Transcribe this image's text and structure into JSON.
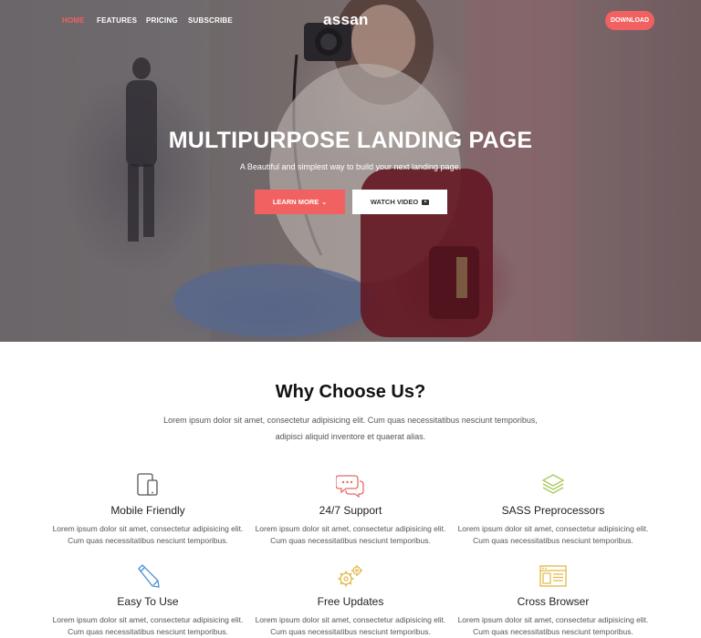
{
  "nav": {
    "links": [
      "HOME",
      "FEATURES",
      "PRICING",
      "SUBSCRIBE"
    ],
    "logo": "assan",
    "download": "DOWNLOAD"
  },
  "hero": {
    "title": "MULTIPURPOSE LANDING PAGE",
    "subtitle": "A Beautiful and simplest way to build your next landing page.",
    "learn_more": "LEARN MORE",
    "watch_video": "WATCH VIDEO"
  },
  "why": {
    "title": "Why Choose Us?",
    "desc_line1": "Lorem ipsum dolor sit amet, consectetur adipisicing elit. Cum quas necessitatibus nesciunt temporibus,",
    "desc_line2": "adipisci aliquid inventore et quaerat alias."
  },
  "features": [
    {
      "title": "Mobile Friendly",
      "line1": "Lorem ipsum dolor sit amet, consectetur adipisicing elit.",
      "line2": "Cum quas necessitatibus nesciunt temporibus."
    },
    {
      "title": "24/7 Support",
      "line1": "Lorem ipsum dolor sit amet, consectetur adipisicing elit.",
      "line2": "Cum quas necessitatibus nesciunt temporibus."
    },
    {
      "title": "SASS Preprocessors",
      "line1": "Lorem ipsum dolor sit amet, consectetur adipisicing elit.",
      "line2": "Cum quas necessitatibus nesciunt temporibus."
    },
    {
      "title": "Easy To Use",
      "line1": "Lorem ipsum dolor sit amet, consectetur adipisicing elit.",
      "line2": "Cum quas necessitatibus nesciunt temporibus."
    },
    {
      "title": "Free Updates",
      "line1": "Lorem ipsum dolor sit amet, consectetur adipisicing elit.",
      "line2": "Cum quas necessitatibus nesciunt temporibus."
    },
    {
      "title": "Cross Browser",
      "line1": "Lorem ipsum dolor sit amet, consectetur adipisicing elit.",
      "line2": "Cum quas necessitatibus nesciunt temporibus."
    }
  ],
  "colors": {
    "accent": "#f26161",
    "icon_mobile": "#555555",
    "icon_support": "#e86a6a",
    "icon_sass": "#a8c957",
    "icon_easy": "#4a90d9",
    "icon_updates": "#e2b743",
    "icon_browser": "#e2b743"
  },
  "icons": [
    "tablet-icon",
    "chat-bubbles-icon",
    "layers-icon",
    "pencil-icon",
    "gears-icon",
    "browser-window-icon"
  ]
}
